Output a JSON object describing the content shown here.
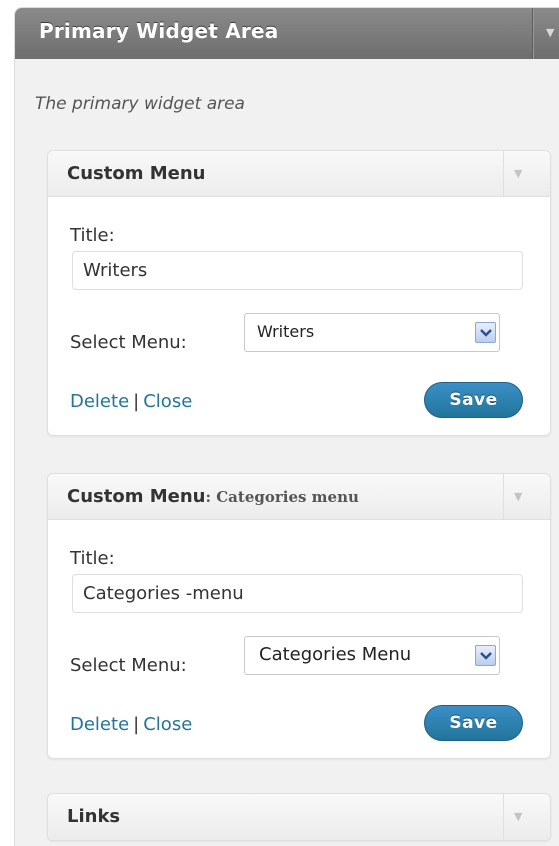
{
  "area": {
    "title": "Primary Widget Area",
    "description": "The primary widget area",
    "arrow": "▼"
  },
  "widgets": [
    {
      "title": "Custom Menu",
      "subtitle": "",
      "title_label": "Title:",
      "title_value": "Writers",
      "menu_label": "Select Menu:",
      "menu_value": "Writers",
      "delete_label": "Delete",
      "separator": "|",
      "close_label": "Close",
      "save_label": "Save"
    },
    {
      "title": "Custom Menu",
      "subtitle": ": Categories menu",
      "title_label": "Title:",
      "title_value": "Categories -menu",
      "menu_label": "Select Menu:",
      "menu_value": "Categories Menu",
      "delete_label": "Delete",
      "separator": "|",
      "close_label": "Close",
      "save_label": "Save"
    },
    {
      "title": "Links"
    }
  ],
  "colors": {
    "header_bg": "#7d7d7d",
    "link": "#21759b",
    "save_button": "#21759b",
    "widget_border": "#dfdfdf"
  },
  "icons": {
    "area_toggle": "triangle-down-icon",
    "widget_toggle": "triangle-down-icon",
    "select_dropdown": "chevron-down-icon"
  }
}
